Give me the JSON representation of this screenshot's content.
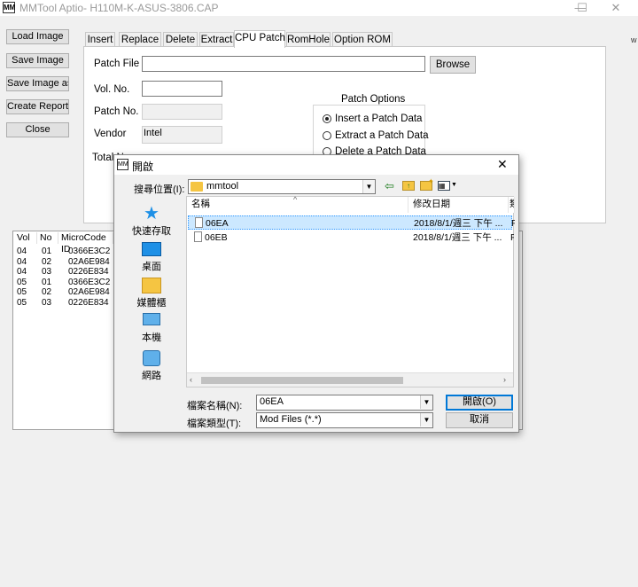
{
  "window": {
    "icon_text": "MM",
    "title": "MMTool Aptio- H110M-K-ASUS-3806.CAP",
    "minimize": "—",
    "maximize": "☐",
    "close": "✕"
  },
  "left_buttons": [
    "Load Image",
    "Save Image",
    "Save Image as..",
    "Create Report",
    "Close"
  ],
  "tabs": [
    "Insert",
    "Replace",
    "Delete",
    "Extract",
    "CPU Patch",
    "RomHole",
    "Option ROM"
  ],
  "active_tab": "CPU Patch",
  "cpu_patch": {
    "patch_file_label": "Patch File",
    "patch_file_value": "",
    "browse_label": "Browse",
    "vol_no_label": "Vol. No.",
    "vol_no_value": "",
    "patch_no_label": "Patch No.",
    "patch_no_value": "",
    "vendor_label": "Vendor",
    "vendor_value": "Intel",
    "total_label": "Total N",
    "patch_options_title": "Patch Options",
    "options": [
      "Insert a Patch Data",
      "Extract a Patch Data",
      "Delete a Patch Data"
    ],
    "selected_option": "Insert a Patch Data"
  },
  "table": {
    "headers": [
      "Vol",
      "No",
      "MicroCode ID"
    ],
    "rows": [
      [
        "04",
        "01",
        "0366E3C2"
      ],
      [
        "04",
        "02",
        "02A6E984"
      ],
      [
        "04",
        "03",
        "0226E834"
      ],
      [
        "05",
        "01",
        "0366E3C2"
      ],
      [
        "05",
        "02",
        "02A6E984"
      ],
      [
        "05",
        "03",
        "0226E834"
      ]
    ]
  },
  "dialog": {
    "title": "開啟",
    "close": "✕",
    "lookin_label": "搜尋位置(I):",
    "lookin_value": "mmtool",
    "places": [
      "快速存取",
      "桌面",
      "媒體櫃",
      "本機",
      "網路"
    ],
    "columns": [
      "名稱",
      "修改日期",
      "類"
    ],
    "files": [
      {
        "name": "06EA",
        "date": "2018/8/1/週三 下午 ...",
        "type": "F",
        "selected": true
      },
      {
        "name": "06EB",
        "date": "2018/8/1/週三 下午 ...",
        "type": "F",
        "selected": false
      }
    ],
    "filename_label": "檔案名稱(N):",
    "filename_value": "06EA",
    "filetype_label": "檔案類型(T):",
    "filetype_value": "Mod Files (*.*)",
    "open_label": "開啟(O)",
    "cancel_label": "取消"
  },
  "colors": {
    "folder": "#f5c542",
    "selection": "#cce8ff",
    "accent": "#0078d7",
    "places_icon_blue": "#1e90e6"
  }
}
